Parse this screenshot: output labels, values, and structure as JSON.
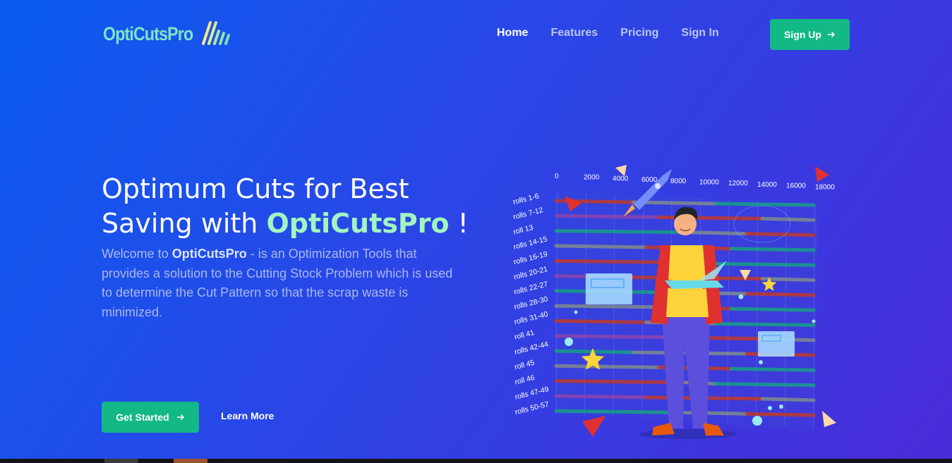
{
  "header": {
    "logo_text": "OptiCutsPro",
    "nav": [
      {
        "label": "Home",
        "active": true
      },
      {
        "label": "Features",
        "active": false
      },
      {
        "label": "Pricing",
        "active": false
      },
      {
        "label": "Sign In",
        "active": false
      }
    ],
    "signup_label": "Sign Up",
    "signup_icon": "arrow-right-icon"
  },
  "hero": {
    "title_line1": "Optimum Cuts for Best",
    "title_line2_prefix": "Saving with ",
    "title_brand": "OptiCutsPro",
    "title_suffix": " !",
    "desc_prefix": "Welcome to ",
    "desc_brand": "OptiCutsPro",
    "desc_rest": " - is an Optimization Tools that provides a solution to the Cutting Stock Problem which is used to determine the Cut Pattern so that the scrap waste is minimized.",
    "get_started_label": "Get Started",
    "learn_more_label": "Learn More"
  },
  "illustration": {
    "axis_ticks": [
      "0",
      "2000",
      "4000",
      "6000",
      "8000",
      "10000",
      "12000",
      "14000",
      "16000",
      "18000"
    ],
    "row_labels": [
      "rolls 1-6",
      "rolls 7-12",
      "roll 13",
      "rolls 14-15",
      "rolls 16-19",
      "rolls 20-21",
      "rolls 22-27",
      "rolls 28-30",
      "rolls 31-40",
      "roll 41",
      "rolls 42-44",
      "roll 45",
      "roll 46",
      "rolls 47-49",
      "rolls 50-57"
    ]
  },
  "colors": {
    "accent": "#12b886",
    "brand_text": "#a2f5c0",
    "bg_start": "#0a5cf0",
    "bg_end": "#4a2bd8"
  }
}
